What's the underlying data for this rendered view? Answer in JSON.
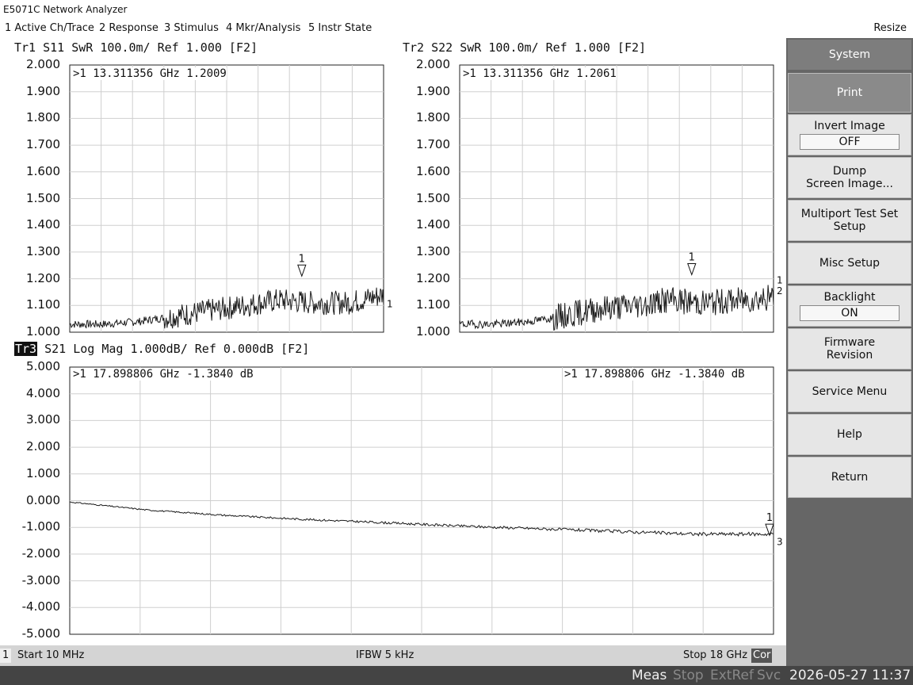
{
  "window": {
    "title": "E5071C Network Analyzer"
  },
  "menu": {
    "items": [
      "1 Active Ch/Trace",
      "2 Response",
      "3 Stimulus",
      "4 Mkr/Analysis",
      "5 Instr State"
    ],
    "resize": "Resize"
  },
  "traces": {
    "tr1": {
      "name": "Tr1",
      "header": "S11 SwR 100.0m/ Ref 1.000 [F2]",
      "marker_readout": ">1  13.311356 GHz  1.2009",
      "y_ticks": [
        "2.000",
        "1.900",
        "1.800",
        "1.700",
        "1.600",
        "1.500",
        "1.400",
        "1.300",
        "1.200",
        "1.100",
        "1.000"
      ],
      "marker_label": "1",
      "end_label": "1"
    },
    "tr2": {
      "name": "Tr2",
      "header": "S22 SwR 100.0m/ Ref 1.000 [F2]",
      "marker_readout": ">1  13.311356 GHz  1.2061",
      "y_ticks": [
        "2.000",
        "1.900",
        "1.800",
        "1.700",
        "1.600",
        "1.500",
        "1.400",
        "1.300",
        "1.200",
        "1.100",
        "1.000"
      ],
      "marker_label": "1",
      "end_label_a": "1",
      "end_label_b": "2"
    },
    "tr3": {
      "name": "Tr3",
      "header": "S21 Log Mag 1.000dB/ Ref 0.000dB [F2]",
      "marker_readout_left": ">1  17.898806 GHz -1.3840 dB",
      "marker_readout_right": ">1  17.898806 GHz  -1.3840 dB",
      "y_ticks": [
        "5.000",
        "4.000",
        "3.000",
        "2.000",
        "1.000",
        "0.000",
        "-1.000",
        "-2.000",
        "-3.000",
        "-4.000",
        "-5.000"
      ],
      "marker_label": "1",
      "end_label": "3"
    }
  },
  "status": {
    "channel": "1",
    "start": "Start 10 MHz",
    "ifbw": "IFBW 5 kHz",
    "stop": "Stop 18 GHz",
    "cor": "Cor"
  },
  "bottom": {
    "meas": "Meas",
    "stop": "Stop",
    "extref": "ExtRef",
    "svc": "Svc",
    "datetime": "2026-05-27 11:37"
  },
  "softkeys": {
    "header": "System",
    "print": "Print",
    "invert_image": "Invert Image",
    "invert_value": "OFF",
    "dump_1": "Dump",
    "dump_2": "Screen Image...",
    "multiport_1": "Multiport Test Set",
    "multiport_2": "Setup",
    "misc": "Misc Setup",
    "backlight": "Backlight",
    "backlight_value": "ON",
    "firmware_1": "Firmware",
    "firmware_2": "Revision",
    "service": "Service Menu",
    "help": "Help",
    "return": "Return"
  },
  "chart_data": [
    {
      "type": "line",
      "title": "Tr1 S11 SwR 100.0m/ Ref 1.000 [F2]",
      "xlabel": "",
      "ylabel": "",
      "xlim": [
        0.01,
        18
      ],
      "ylim": [
        1.0,
        2.0
      ],
      "x": [
        0.01,
        2,
        4,
        6,
        8,
        10,
        12,
        13.311356,
        14,
        16,
        18
      ],
      "series": [
        {
          "name": "",
          "values": [
            1.03,
            1.03,
            1.04,
            1.06,
            1.08,
            1.1,
            1.12,
            1.2009,
            1.11,
            1.11,
            1.14
          ]
        }
      ],
      "grid": true
    },
    {
      "type": "line",
      "title": "Tr2 S22 SwR 100.0m/ Ref 1.000 [F2]",
      "xlabel": "",
      "ylabel": "",
      "xlim": [
        0.01,
        18
      ],
      "ylim": [
        1.0,
        2.0
      ],
      "x": [
        0.01,
        2,
        4,
        6,
        8,
        10,
        12,
        13.311356,
        14,
        16,
        18
      ],
      "series": [
        {
          "name": "",
          "values": [
            1.03,
            1.03,
            1.04,
            1.06,
            1.09,
            1.1,
            1.12,
            1.2061,
            1.11,
            1.12,
            1.13
          ]
        }
      ],
      "grid": true
    },
    {
      "type": "line",
      "title": "Tr3 S21 Log Mag 1.000dB/ Ref 0.000dB [F2]",
      "xlabel": "",
      "ylabel": "",
      "xlim": [
        0.01,
        18
      ],
      "ylim": [
        -5.0,
        5.0
      ],
      "x": [
        0.01,
        2,
        4,
        6,
        8,
        10,
        12,
        14,
        16,
        17.898806
      ],
      "series": [
        {
          "name": "",
          "values": [
            -0.05,
            -0.35,
            -0.55,
            -0.7,
            -0.82,
            -0.95,
            -1.05,
            -1.15,
            -1.25,
            -1.384
          ]
        }
      ],
      "grid": true
    }
  ]
}
